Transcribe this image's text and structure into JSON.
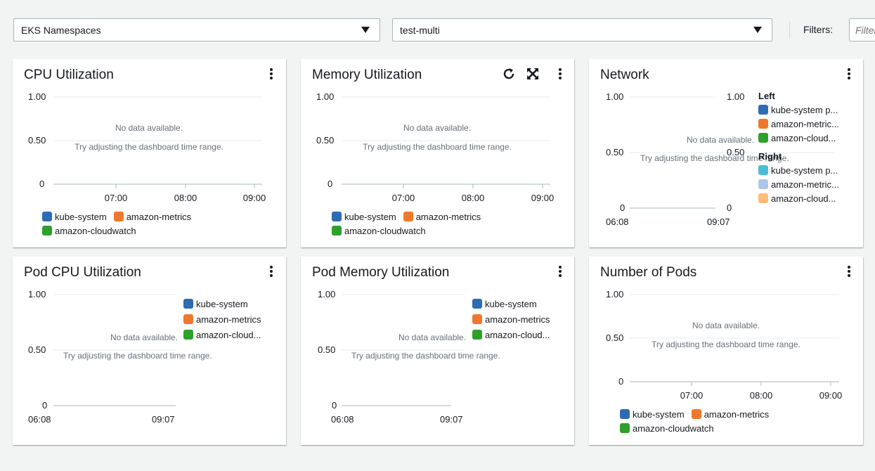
{
  "toolbar": {
    "namespace_select": "EKS Namespaces",
    "cluster_select": "test-multi",
    "filters_label": "Filters:",
    "filter_placeholder": "Filter"
  },
  "colors": {
    "kube_system": "#2e6bb5",
    "amazon_metrics": "#f0782d",
    "amazon_cloudwatch": "#2ea02c",
    "kube_system_right": "#4bbdd2",
    "amazon_metrics_right": "#aec7e8",
    "amazon_cloudwatch_right": "#ffbb78"
  },
  "empty_state": {
    "line1": "No data available.",
    "line2": "Try adjusting the dashboard time range."
  },
  "panels": {
    "cpu": {
      "title": "CPU Utilization",
      "y_ticks": [
        "1.00",
        "0.50",
        "0"
      ],
      "x_ticks": [
        "07:00",
        "08:00",
        "09:00"
      ],
      "legend": [
        "kube-system",
        "amazon-metrics",
        "amazon-cloudwatch"
      ]
    },
    "memory": {
      "title": "Memory Utilization",
      "y_ticks": [
        "1.00",
        "0.50",
        "0"
      ],
      "x_ticks": [
        "07:00",
        "08:00",
        "09:00"
      ],
      "legend": [
        "kube-system",
        "amazon-metrics",
        "amazon-cloudwatch"
      ],
      "refresh_icon": "refresh-icon",
      "fullscreen_icon": "fullscreen-icon"
    },
    "network": {
      "title": "Network",
      "y_ticks_left": [
        "1.00",
        "0.50",
        "0"
      ],
      "y_ticks_right": [
        "1.00",
        "0.50",
        "0"
      ],
      "x_ticks": [
        "06:08",
        "09:07"
      ],
      "legend_left_title": "Left",
      "legend_left": [
        "kube-system p...",
        "amazon-metric...",
        "amazon-cloud..."
      ],
      "legend_right_title": "Right",
      "legend_right": [
        "kube-system p...",
        "amazon-metric...",
        "amazon-cloud..."
      ],
      "empty_line1": "No data available."
    },
    "pod_cpu": {
      "title": "Pod CPU Utilization",
      "y_ticks": [
        "1.00",
        "0.50",
        "0"
      ],
      "x_ticks": [
        "06:08",
        "09:07"
      ],
      "legend": [
        "kube-system",
        "amazon-metrics",
        "amazon-cloud..."
      ],
      "empty_line1": "No data available."
    },
    "pod_memory": {
      "title": "Pod Memory Utilization",
      "y_ticks": [
        "1.00",
        "0.50",
        "0"
      ],
      "x_ticks": [
        "06:08",
        "09:07"
      ],
      "legend": [
        "kube-system",
        "amazon-metrics",
        "amazon-cloud..."
      ],
      "empty_line1": "No data available."
    },
    "pods": {
      "title": "Number of Pods",
      "y_ticks": [
        "1.00",
        "0.50",
        "0"
      ],
      "x_ticks": [
        "07:00",
        "08:00",
        "09:00"
      ],
      "legend": [
        "kube-system",
        "amazon-metrics",
        "amazon-cloudwatch"
      ]
    }
  }
}
